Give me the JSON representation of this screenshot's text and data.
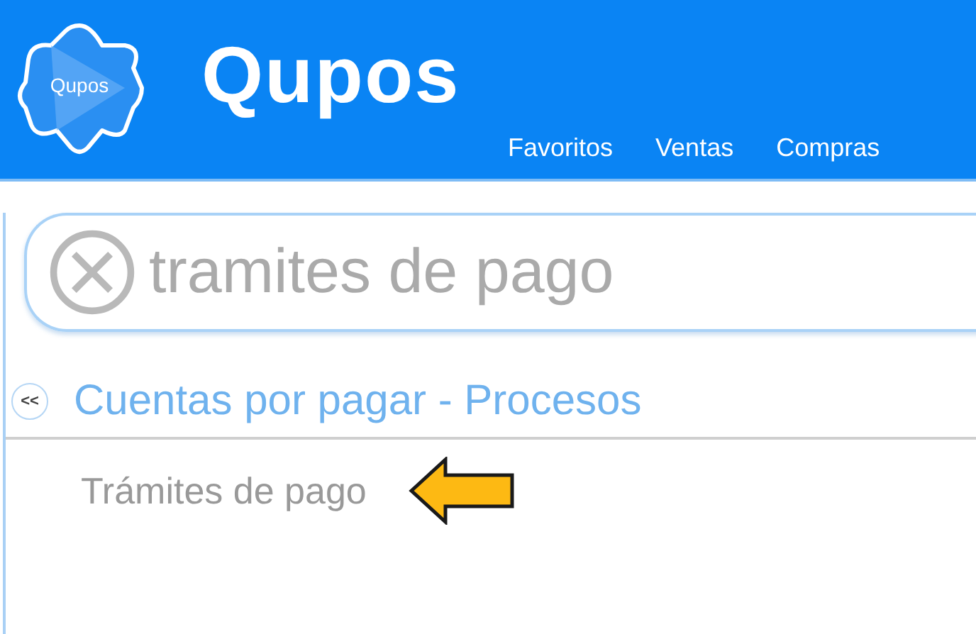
{
  "header": {
    "logo_badge_text": "Qupos",
    "brand": "Qupos",
    "nav": [
      {
        "label": "Favoritos"
      },
      {
        "label": "Ventas"
      },
      {
        "label": "Compras"
      }
    ]
  },
  "search": {
    "value": "tramites de pago"
  },
  "section": {
    "back_label": "<<",
    "title": "Cuentas por pagar - Procesos"
  },
  "items": [
    {
      "label": "Trámites de pago",
      "pointed": true
    }
  ]
}
